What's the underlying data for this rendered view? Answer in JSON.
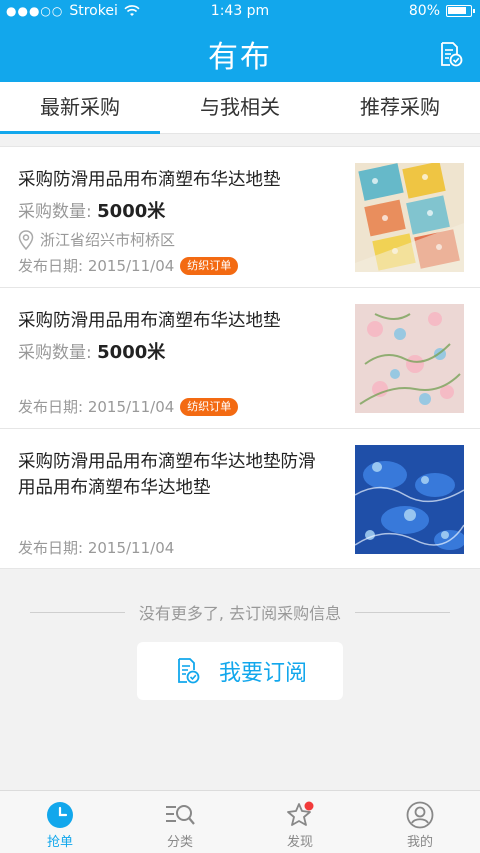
{
  "status_bar": {
    "carrier": "Strokei",
    "time": "1:43 pm",
    "battery": "80%"
  },
  "header": {
    "title": "有布",
    "action_icon": "subscribe-doc-icon"
  },
  "tabs": [
    {
      "label": "最新采购",
      "active": true
    },
    {
      "label": "与我相关",
      "active": false
    },
    {
      "label": "推荐采购",
      "active": false
    }
  ],
  "items": [
    {
      "title": "采购防滑用品用布滴塑布华达地垫",
      "qty_label": "采购数量: ",
      "qty_value": "5000米",
      "location": "浙江省绍兴市柯桥区",
      "date": "发布日期: 2015/11/04",
      "badge": "纺织订单"
    },
    {
      "title": "采购防滑用品用布滴塑布华达地垫",
      "qty_label": "采购数量: ",
      "qty_value": "5000米",
      "date": "发布日期: 2015/11/04",
      "badge": "纺织订单"
    },
    {
      "title": "采购防滑用品用布滴塑布华达地垫防滑用品用布滴塑布华达地垫",
      "date": "发布日期: 2015/11/04"
    }
  ],
  "footer": {
    "no_more": "没有更多了, 去订阅采购信息",
    "subscribe_label": "我要订阅"
  },
  "tabbar": [
    {
      "label": "抢单",
      "icon": "clock-icon",
      "active": true
    },
    {
      "label": "分类",
      "icon": "category-search-icon",
      "active": false
    },
    {
      "label": "发现",
      "icon": "star-icon",
      "active": false
    },
    {
      "label": "我的",
      "icon": "user-icon",
      "active": false
    }
  ],
  "colors": {
    "primary": "#12a7ec",
    "badge": "#f36a12",
    "notify_dot": "#f23b3b"
  }
}
